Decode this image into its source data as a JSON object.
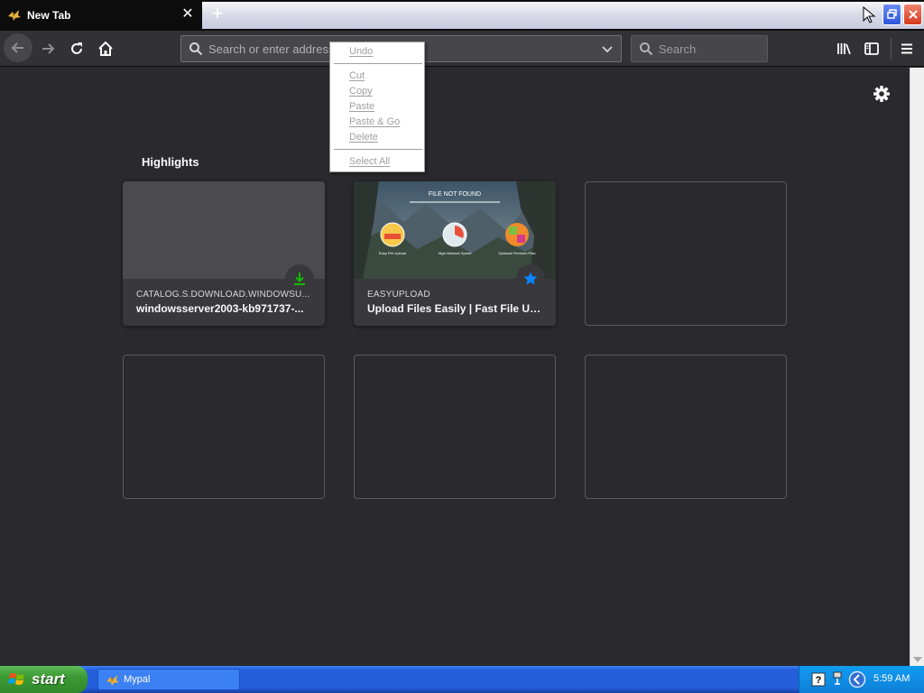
{
  "browser": {
    "tab": {
      "title": "New Tab",
      "close_glyph": "✕"
    },
    "new_tab_glyph": "+",
    "urlbar": {
      "placeholder": "Search or enter address"
    },
    "searchbar": {
      "placeholder": "Search"
    }
  },
  "context_menu": {
    "items": [
      "Undo",
      "Cut",
      "Copy",
      "Paste",
      "Paste & Go",
      "Delete",
      "Select All"
    ],
    "enabled": false
  },
  "newtab": {
    "section_title": "Highlights",
    "cards": [
      {
        "host": "CATALOG.S.DOWNLOAD.WINDOWSU...",
        "title": "windowsserver2003-kb971737-...",
        "badge": "download-icon",
        "badge_color": "#12bc00"
      },
      {
        "host": "EASYUPLOAD",
        "title": "Upload Files Easily | Fast File Upl...",
        "badge": "star-icon",
        "badge_color": "#0a84ff",
        "thumb": {
          "heading": "FILE NOT FOUND",
          "captions": [
            "Easy File Upload",
            "High Network Speed",
            "Optional Premium Plan"
          ]
        }
      }
    ]
  },
  "taskbar": {
    "start_label": "start",
    "task": {
      "label": "Mypal"
    },
    "clock": "5:59 AM"
  },
  "colors": {
    "page_bg": "#2a2a2e",
    "toolbar_bg": "#323234",
    "card_bg": "#38383d",
    "taskbar_blue": "#245edb",
    "start_green": "#3c9a34"
  }
}
